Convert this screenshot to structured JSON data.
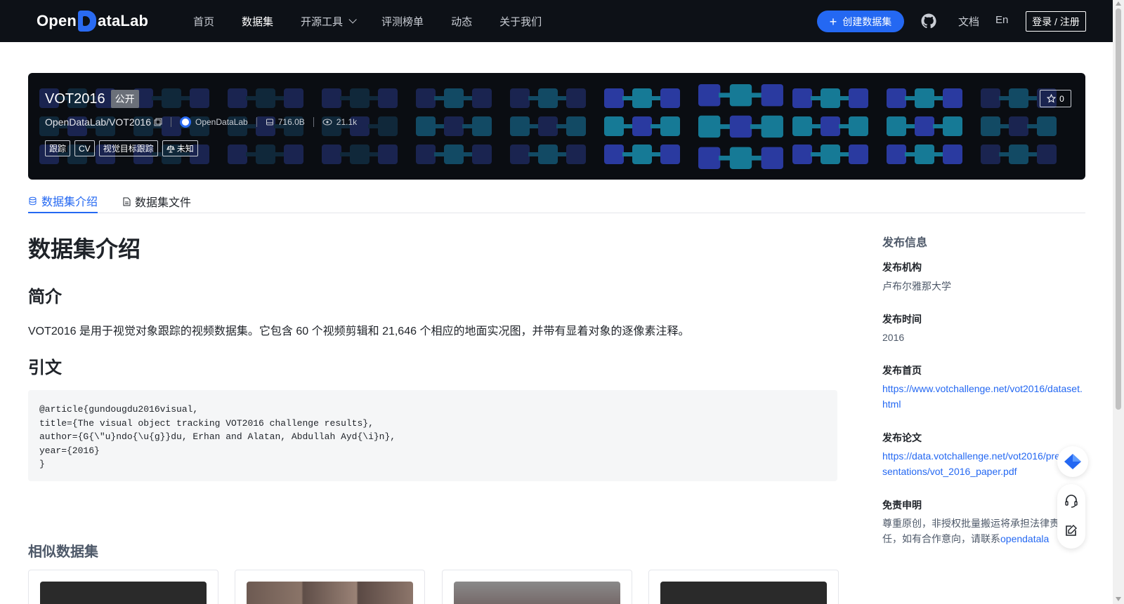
{
  "nav": {
    "logo_text_left": "Open",
    "logo_text_right": "ataLab",
    "links": [
      {
        "label": "首页",
        "active": false
      },
      {
        "label": "数据集",
        "active": true
      },
      {
        "label": "开源工具",
        "active": false,
        "dropdown": true
      },
      {
        "label": "评测榜单",
        "active": false
      },
      {
        "label": "动态",
        "active": false
      },
      {
        "label": "关于我们",
        "active": false
      }
    ],
    "create_button": "创建数据集",
    "docs": "文档",
    "lang": "En",
    "login": "登录 / 注册"
  },
  "banner": {
    "name": "VOT2016",
    "visibility": "公开",
    "path": "OpenDataLab/VOT2016",
    "org": "OpenDataLab",
    "size": "716.0B",
    "views": "21.1k",
    "tags": [
      "跟踪",
      "CV",
      "视觉目标跟踪"
    ],
    "license": "未知",
    "stars": "0"
  },
  "tabs": {
    "intro": "数据集介绍",
    "files": "数据集文件"
  },
  "main": {
    "title": "数据集介绍",
    "summary_heading": "简介",
    "summary": "VOT2016 是用于视觉对象跟踪的视频数据集。它包含 60 个视频剪辑和 21,646 个相应的地面实况图，并带有显着对象的逐像素注释。",
    "citation_heading": "引文",
    "citation": "@article{gundougdu2016visual,\ntitle={The visual object tracking VOT2016 challenge results},\nauthor={G{\\\"u}ndo{\\u{g}}du, Erhan and Alatan, Abdullah Ayd{\\i}n},\nyear={2016}\n}",
    "similar_heading": "相似数据集"
  },
  "side": {
    "title": "发布信息",
    "org_label": "发布机构",
    "org": "卢布尔雅那大学",
    "time_label": "发布时间",
    "time": "2016",
    "home_label": "发布首页",
    "home": "https://www.votchallenge.net/vot2016/dataset.html",
    "paper_label": "发布论文",
    "paper": "https://data.votchallenge.net/vot2016/presentations/vot_2016_paper.pdf",
    "disclaimer_label": "免责申明",
    "disclaimer_text": "尊重原创，非授权批量搬运将承担法律责任，如有合作意向，请联系",
    "disclaimer_link": "opendatalab",
    "disclaimer_end": "。"
  },
  "colors": {
    "nav_bg": "#0d1117",
    "accent": "#2468f2",
    "banner_bg": "#0a0d12"
  }
}
